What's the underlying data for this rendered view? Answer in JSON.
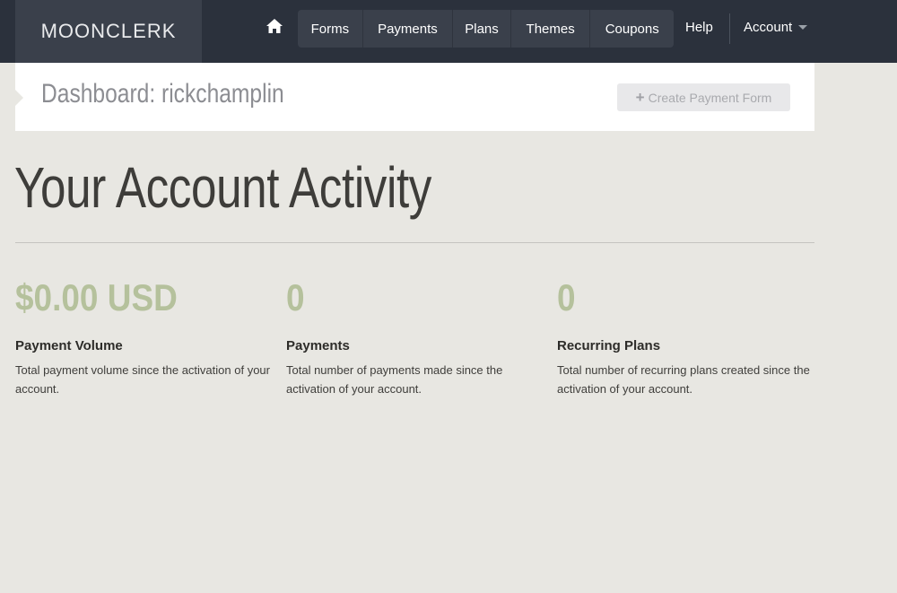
{
  "nav": {
    "logo": "MOONCLERK",
    "home_icon": "home-icon",
    "items": [
      {
        "label": "Forms"
      },
      {
        "label": "Payments"
      },
      {
        "label": "Plans"
      },
      {
        "label": "Themes"
      },
      {
        "label": "Coupons"
      }
    ],
    "help": "Help",
    "account": "Account",
    "account_icon": "chevron-down-icon"
  },
  "dashboard": {
    "title": "Dashboard: rickchamplin",
    "create_button": "Create Payment Form",
    "create_icon": "plus-icon"
  },
  "main": {
    "heading": "Your Account Activity",
    "stats": [
      {
        "value": "$0.00 USD",
        "label": "Payment Volume",
        "description": "Total payment volume since the activation of your account."
      },
      {
        "value": "0",
        "label": "Payments",
        "description": "Total number of payments made since the activation of your account."
      },
      {
        "value": "0",
        "label": "Recurring Plans",
        "description": "Total number of recurring plans created since the activation of your account."
      }
    ]
  },
  "colors": {
    "topbar": "#2b313c",
    "background": "#e8e7e2",
    "stat_value": "#b5c19c"
  }
}
